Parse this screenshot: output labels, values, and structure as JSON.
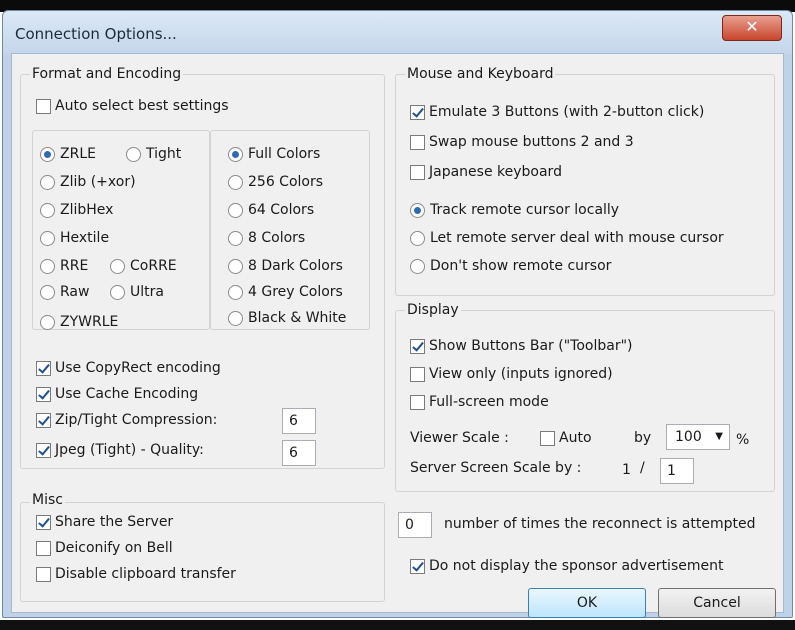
{
  "top_strip": "",
  "title": "Connection Options...",
  "close_glyph": "✕",
  "format": {
    "label": "Format and Encoding",
    "auto_select": "Auto select best settings",
    "encodings": [
      {
        "label": "ZRLE",
        "checked": true
      },
      {
        "label": "Tight",
        "checked": false
      },
      {
        "label": "Zlib (+xor)",
        "checked": false
      },
      {
        "label": "ZlibHex",
        "checked": false
      },
      {
        "label": "Hextile",
        "checked": false
      },
      {
        "label": "RRE",
        "checked": false
      },
      {
        "label": "CoRRE",
        "checked": false
      },
      {
        "label": "Raw",
        "checked": false
      },
      {
        "label": "Ultra",
        "checked": false
      },
      {
        "label": "ZYWRLE",
        "checked": false
      }
    ],
    "colors": [
      {
        "label": "Full Colors",
        "checked": true
      },
      {
        "label": "256 Colors",
        "checked": false
      },
      {
        "label": "64 Colors",
        "checked": false
      },
      {
        "label": "8 Colors",
        "checked": false
      },
      {
        "label": "8 Dark Colors",
        "checked": false
      },
      {
        "label": "4 Grey Colors",
        "checked": false
      },
      {
        "label": "Black & White",
        "checked": false
      }
    ],
    "use_copyrect": "Use CopyRect encoding",
    "use_cache": "Use Cache Encoding",
    "zip_tight": "Zip/Tight Compression:",
    "zip_value": "6",
    "jpeg": "Jpeg (Tight) - Quality:",
    "jpeg_value": "6"
  },
  "misc": {
    "label": "Misc",
    "share": "Share the Server",
    "deiconify": "Deiconify on Bell",
    "disable_clipboard": "Disable clipboard transfer"
  },
  "mouse": {
    "label": "Mouse and Keyboard",
    "emulate3": "Emulate 3 Buttons (with 2-button click)",
    "swap": "Swap mouse buttons 2 and 3",
    "japanese": "Japanese keyboard",
    "track_local": "Track remote cursor locally",
    "let_remote": "Let remote server deal with mouse cursor",
    "dont_show": "Don't show remote cursor"
  },
  "display": {
    "label": "Display",
    "show_toolbar": "Show Buttons Bar (\"Toolbar\")",
    "view_only": "View only (inputs ignored)",
    "fullscreen": "Full-screen mode",
    "viewer_scale": "Viewer Scale :",
    "auto": "Auto",
    "by": "by",
    "scale_value": "100",
    "percent": "%",
    "server_scale": "Server Screen Scale by :",
    "server_num": "1",
    "slash": "/",
    "server_den": "1"
  },
  "reconnect": {
    "value": "0",
    "label": "number of times the reconnect is attempted"
  },
  "sponsor": "Do not display the sponsor advertisement",
  "ok": "OK",
  "cancel": "Cancel"
}
